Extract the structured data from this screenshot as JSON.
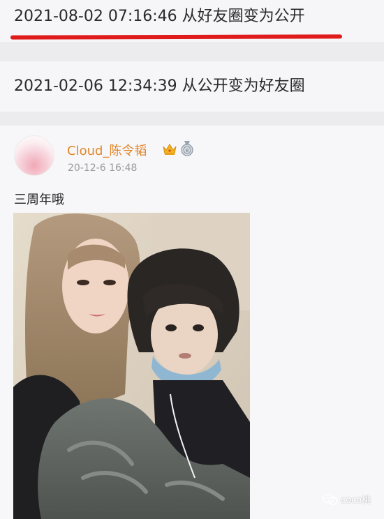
{
  "records": [
    {
      "text": "2021-08-02 07:16:46 从好友圈变为公开"
    },
    {
      "text": "2021-02-06 12:34:39 从公开变为好友圈"
    }
  ],
  "post": {
    "username": "Cloud_陈令韬",
    "timestamp": "20-12-6 16:48",
    "text": "三周年哦",
    "badges": [
      "crown-icon",
      "medal-icon"
    ]
  },
  "watermark": {
    "text": "coco桃",
    "icon": "wechat-icon"
  },
  "colors": {
    "username": "#e2862a",
    "underline": "#e01b1b",
    "timestamp": "#9a9a9a"
  }
}
